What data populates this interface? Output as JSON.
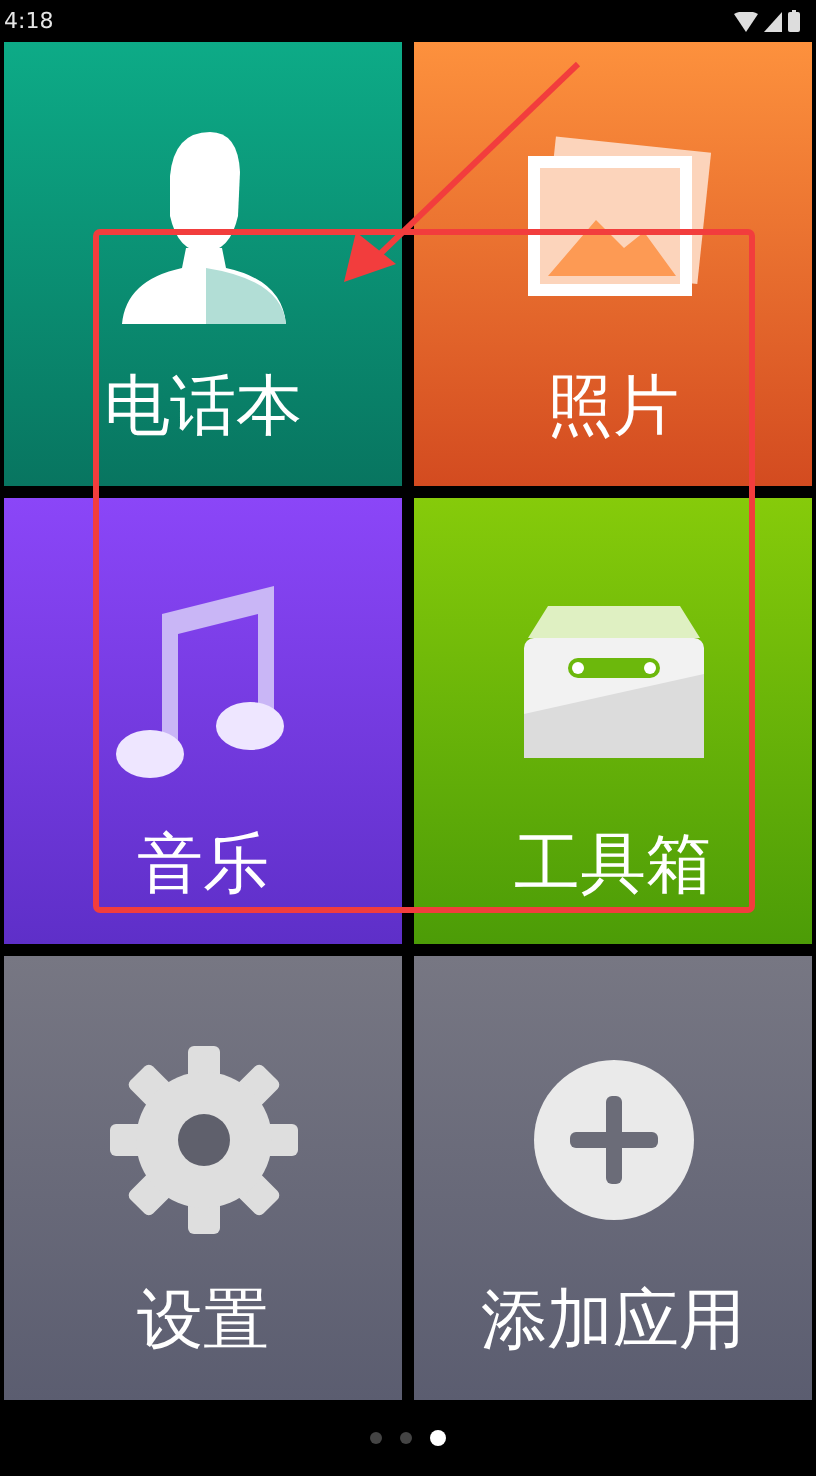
{
  "status_bar": {
    "time": "4:18"
  },
  "tiles": [
    {
      "kind": "contacts",
      "label": "电话本"
    },
    {
      "kind": "photos",
      "label": "照片"
    },
    {
      "kind": "music",
      "label": "音乐"
    },
    {
      "kind": "toolbox",
      "label": "工具箱"
    },
    {
      "kind": "settings",
      "label": "设置"
    },
    {
      "kind": "add",
      "label": "添加应用"
    }
  ],
  "pages": [
    {
      "selected": false
    },
    {
      "selected": false
    },
    {
      "selected": true
    }
  ]
}
